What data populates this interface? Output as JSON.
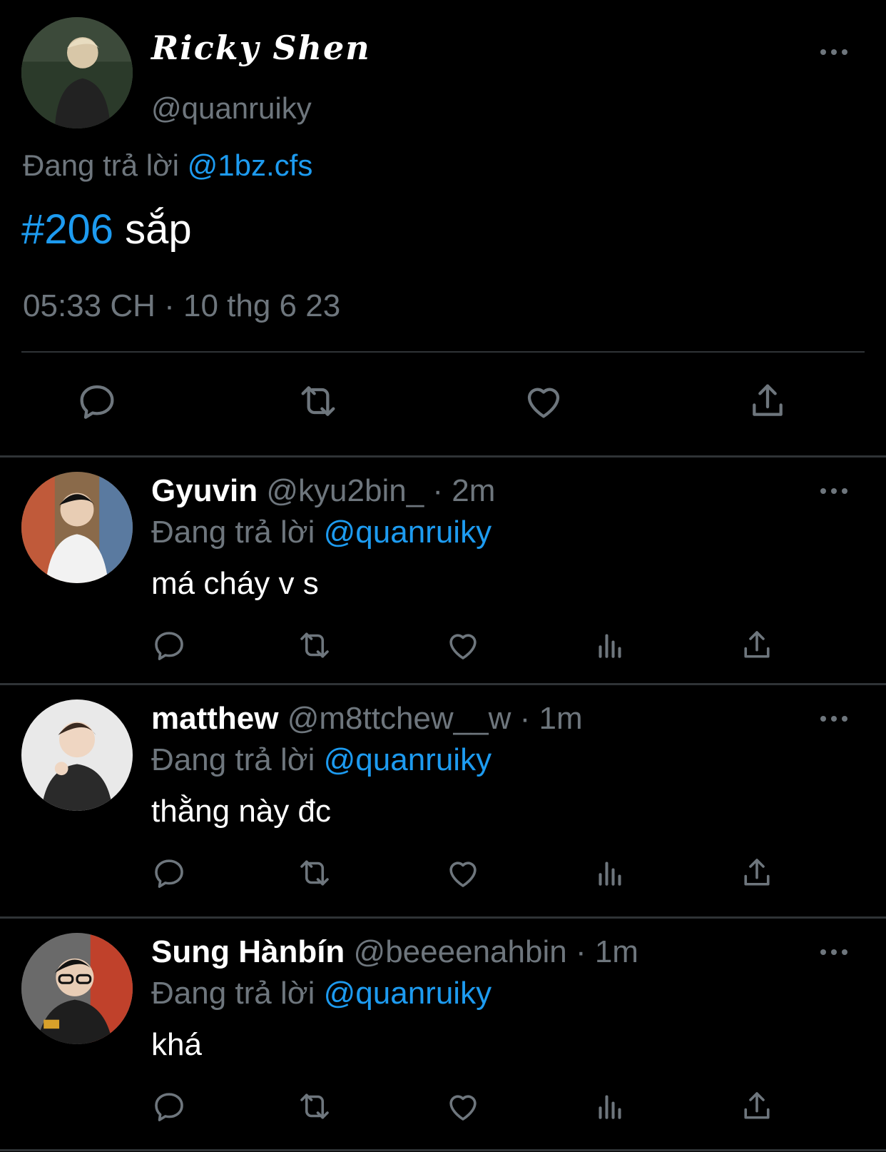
{
  "main_tweet": {
    "display_name": "Ricky Shen",
    "handle": "@quanruiky",
    "replying_prefix": "Đang trả lời",
    "replying_to": "@1bz.cfs",
    "hashtag": "#206",
    "text": " sắp",
    "timestamp": "05:33 CH · 10 thg 6 23",
    "actions": [
      "reply-icon",
      "retweet-icon",
      "like-icon",
      "share-icon"
    ]
  },
  "replies": [
    {
      "name": "Gyuvin",
      "handle": "@kyu2bin_",
      "time": "· 2m",
      "replying_prefix": "Đang trả lời",
      "replying_to": "@quanruiky",
      "text": "má cháy v s"
    },
    {
      "name": "matthew",
      "handle": "@m8ttchew__w",
      "time": "· 1m",
      "replying_prefix": "Đang trả lời",
      "replying_to": "@quanruiky",
      "text": "thằng này đc"
    },
    {
      "name": "Sung Hànbín",
      "handle": "@beeeenahbin",
      "time": "· 1m",
      "replying_prefix": "Đang trả lời",
      "replying_to": "@quanruiky",
      "text": "khá"
    }
  ],
  "colors": {
    "background": "#000000",
    "text_primary": "#ffffff",
    "text_secondary": "#6e767d",
    "link": "#1d9bf0",
    "divider": "#2f3336"
  }
}
